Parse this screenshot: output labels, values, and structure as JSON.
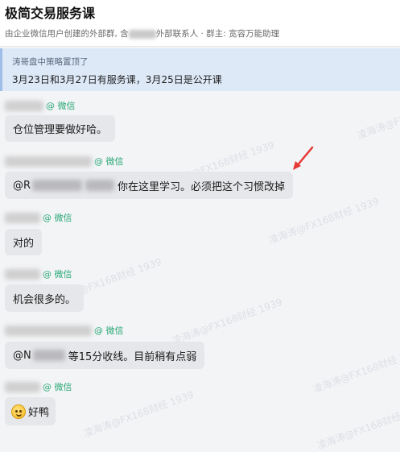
{
  "header": {
    "title": "极简交易服务课",
    "subtitle_prefix": "由企业微信用户创建的外部群, 含",
    "subtitle_suffix": "外部联系人 · 群主: 宽容万能助理"
  },
  "pinned": {
    "title": "涛哥盘中策略置顶了",
    "text": "3月23日和3月27日有服务课，3月25日是公开课"
  },
  "tag": "@ 微信",
  "messages": [
    {
      "text": "仓位管理要做好哈。"
    },
    {
      "prefix": "@R",
      "text": "你在这里学习。必须把这个习惯改掉"
    },
    {
      "text": "对的"
    },
    {
      "text": "机会很多的。"
    },
    {
      "prefix": "@N",
      "text": "等15分收线。目前稍有点弱"
    },
    {
      "text": "好鸭"
    }
  ],
  "watermarks": [
    "凌海涛@FX168财经 1939",
    "凌海涛@FX168财经 1939",
    "凌海涛@FX168财经 1939",
    "凌海涛@FX168财经 1939",
    "凌海涛@FX168财经 1939",
    "凌海涛@FX168财经 1939",
    "凌海涛@FX168财经 1939",
    "凌海涛@FX168财经 1939"
  ],
  "colors": {
    "tag": "#2aa876",
    "arrow": "#e53935",
    "pinned_bg": "#dde9f7"
  }
}
